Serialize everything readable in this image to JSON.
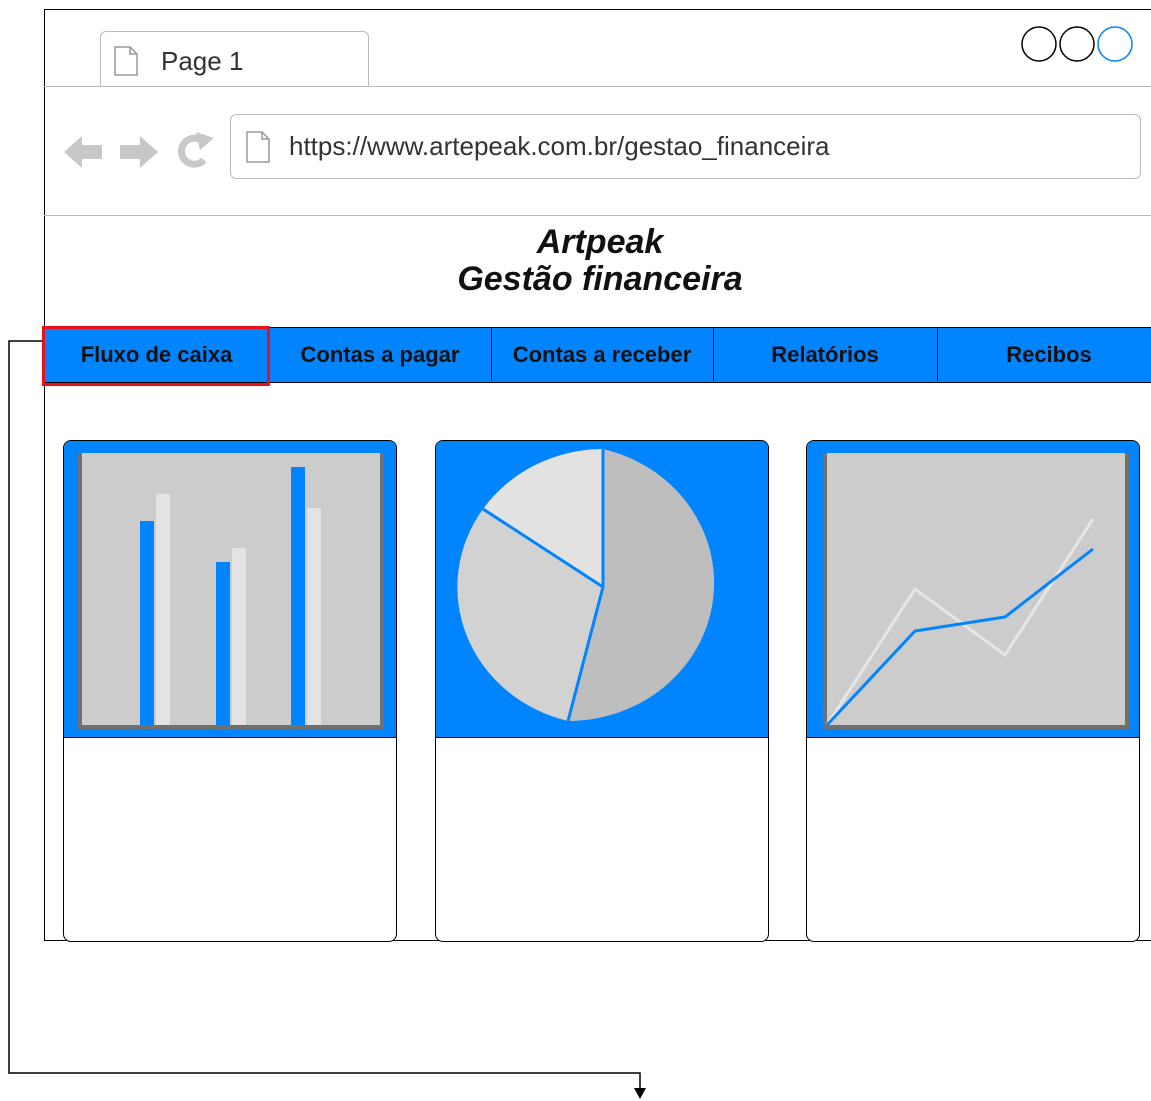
{
  "browser": {
    "tab_label": "Page 1",
    "url": "https://www.artepeak.com.br/gestao_financeira",
    "accent_color": "#0084ff"
  },
  "app": {
    "brand": "Artpeak",
    "subtitle": "Gestão financeira"
  },
  "menu": {
    "items": [
      {
        "label": "Fluxo de caixa",
        "active": true
      },
      {
        "label": "Contas a pagar"
      },
      {
        "label": "Contas a receber"
      },
      {
        "label": "Relatórios"
      },
      {
        "label": "Recibos"
      }
    ],
    "active_border_color": "#e8101d"
  },
  "widgets": [
    {
      "icon": "bar-chart-icon"
    },
    {
      "icon": "pie-chart-icon"
    },
    {
      "icon": "line-chart-icon"
    }
  ]
}
